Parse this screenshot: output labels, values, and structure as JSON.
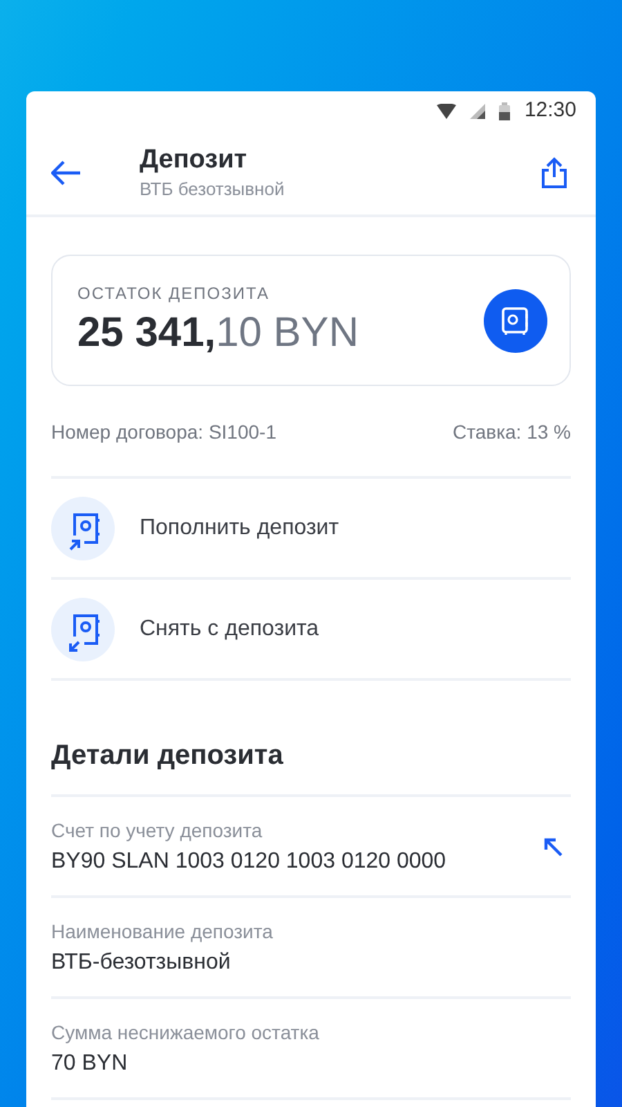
{
  "status_bar": {
    "time": "12:30"
  },
  "header": {
    "title": "Депозит",
    "subtitle": "ВТБ безотзывной"
  },
  "balance": {
    "label": "ОСТАТОК ДЕПОЗИТА",
    "amount_main": "25 341,",
    "amount_rest": "10 BYN"
  },
  "contract": {
    "number": "Номер договора: SI100-1",
    "rate": "Ставка: 13 %"
  },
  "actions": [
    {
      "label": "Пополнить депозит",
      "kind": "top_up"
    },
    {
      "label": "Снять с депозита",
      "kind": "withdraw"
    }
  ],
  "details": {
    "title": "Детали депозита",
    "rows": [
      {
        "label": "Счет по учету депозита",
        "value": "BY90 SLAN 1003 0120 1003 0120 0000",
        "kind": "link"
      },
      {
        "label": "Наименование депозита",
        "value": "ВТБ-безотзывной",
        "kind": "plain"
      },
      {
        "label": "Сумма неснижаемого остатка",
        "value": "70 BYN",
        "kind": "plain"
      }
    ]
  }
}
